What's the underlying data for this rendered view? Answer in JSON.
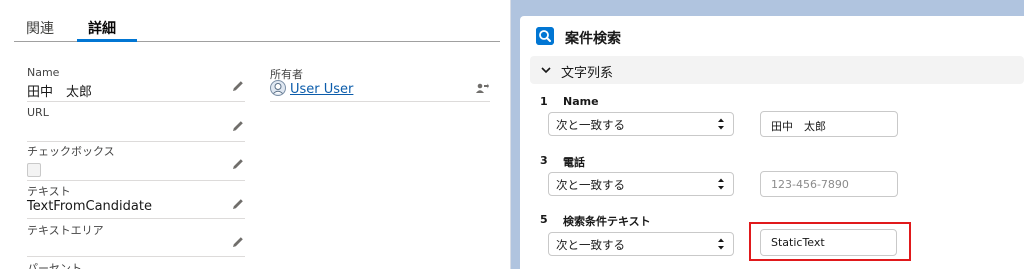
{
  "detail_panel": {
    "tabs": [
      {
        "label": "関連"
      },
      {
        "label": "詳細"
      }
    ],
    "fields": {
      "name": {
        "label": "Name",
        "value": "田中　太郎"
      },
      "url": {
        "label": "URL",
        "value": ""
      },
      "checkbox": {
        "label": "チェックボックス"
      },
      "text": {
        "label": "テキスト",
        "value": "TextFromCandidate"
      },
      "textarea": {
        "label": "テキストエリア",
        "value": ""
      },
      "percent": {
        "label": "パーセント"
      },
      "owner": {
        "label": "所有者",
        "value": "User User"
      }
    }
  },
  "search_panel": {
    "title": "案件検索",
    "section": {
      "title": "文字列系"
    },
    "criteria": [
      {
        "number": "1",
        "label": "Name",
        "operator": "次と一致する",
        "value": "田中　太郎",
        "placeholder": ""
      },
      {
        "number": "3",
        "label": "電話",
        "operator": "次と一致する",
        "value": "",
        "placeholder": "123-456-7890"
      },
      {
        "number": "5",
        "label": "検索条件テキスト",
        "operator": "次と一致する",
        "value": "StaticText",
        "placeholder": ""
      }
    ]
  },
  "colors": {
    "accent": "#0176d3",
    "highlight": "#e0191b",
    "link": "#0b5cab"
  }
}
